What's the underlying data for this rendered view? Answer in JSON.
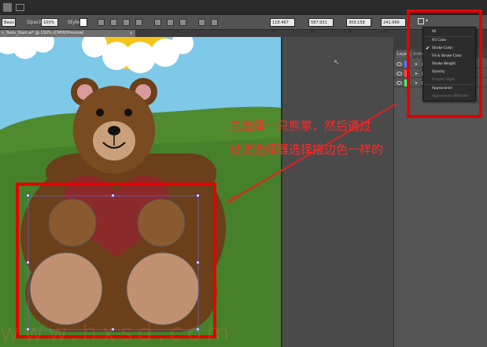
{
  "menubar": {
    "icon": "app-icon"
  },
  "controlbar": {
    "stroke_style": "Basic",
    "opacity_label": "Opacity:",
    "opacity_value": "100%",
    "style_label": "Style:",
    "x_value": "118.467 pt",
    "y_value": "587.931 pt",
    "w_value": "309.158 pt",
    "h_value": "241.966 pt"
  },
  "document_tab": {
    "title": "n_Tools_Start.ai* @ 150% (CMYK/Preview)",
    "close": "×"
  },
  "layers_panel": {
    "tabs": [
      "Layers",
      "Artboards"
    ]
  },
  "select_same_menu": {
    "items": [
      {
        "label": "All",
        "checked": false,
        "disabled": false
      },
      {
        "label": "Fill Color",
        "checked": false,
        "disabled": false
      },
      {
        "label": "Stroke Color",
        "checked": true,
        "disabled": false
      },
      {
        "label": "Fill & Stroke Color",
        "checked": false,
        "disabled": false
      },
      {
        "label": "Stroke Weight",
        "checked": false,
        "disabled": false
      },
      {
        "label": "Opacity",
        "checked": false,
        "disabled": false
      },
      {
        "label": "Graphic Style",
        "checked": false,
        "disabled": true
      },
      {
        "label": "Appearance",
        "checked": false,
        "disabled": false
      },
      {
        "label": "Appearance Attribute",
        "checked": false,
        "disabled": true
      }
    ]
  },
  "annotation": {
    "line1": "先选择一只熊掌，然后通过",
    "line2": "过滤选择器选择描边色一样的"
  },
  "colors": {
    "sky": "#7ec8e8",
    "grass": "#4f8a2f",
    "bear_dark": "#6a3f1a",
    "bear_light": "#8a5a2e",
    "paw": "#c09070",
    "heart": "#8b2a2a",
    "annotation_red": "#e30000"
  },
  "watermark": "www.hxsd.com"
}
